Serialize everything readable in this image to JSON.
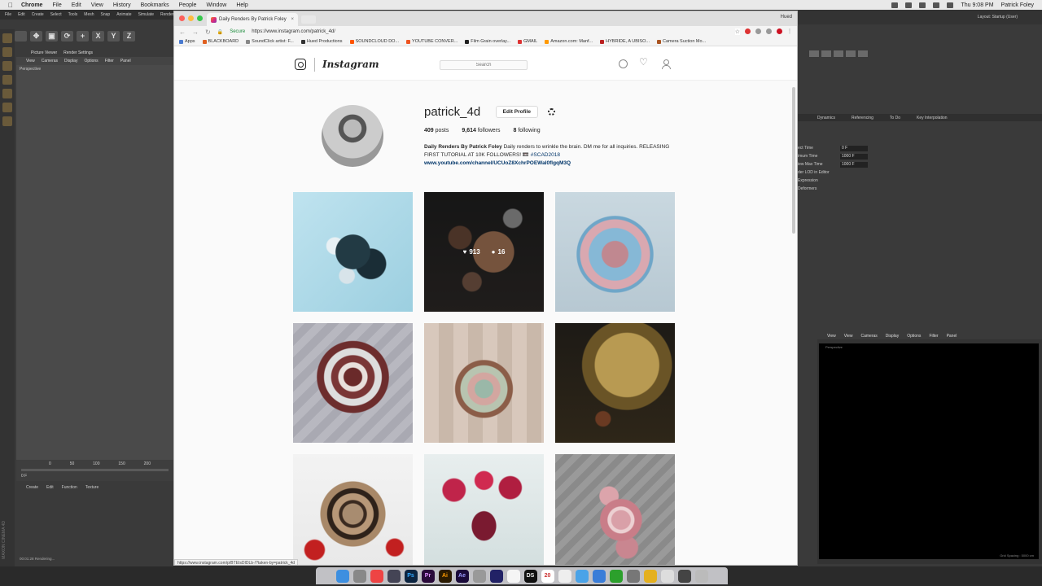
{
  "menubar": {
    "app": "Chrome",
    "items": [
      "File",
      "Edit",
      "View",
      "History",
      "Bookmarks",
      "People",
      "Window",
      "Help"
    ],
    "clock": "Thu 9:08 PM",
    "user": "Patrick Foley"
  },
  "c4d_left": {
    "menu": [
      "File",
      "Edit",
      "Create",
      "Select",
      "Tools",
      "Mesh",
      "Snap",
      "Animate",
      "Simulate",
      "Render"
    ],
    "axis_buttons": [
      "X",
      "Y",
      "Z"
    ],
    "viewer_tabs": [
      "Picture Viewer",
      "Render Settings"
    ],
    "view_menu": [
      "View",
      "Cameras",
      "Display",
      "Options",
      "Filter",
      "Panel"
    ],
    "viewport_label": "Perspective",
    "timeline_ticks": [
      "0",
      "50",
      "100",
      "150",
      "200"
    ],
    "frame_field": "0 F",
    "material_menu": [
      "Create",
      "Edit",
      "Function",
      "Texture"
    ],
    "render_status": "00:01:28 Rendering...",
    "brand": "MAXON CINEMA 4D"
  },
  "c4d_right": {
    "layout_label": "Layout:",
    "layout_value": "Startup (User)",
    "attr_tabs": [
      "Dynamics",
      "Referencing",
      "To Do",
      "Key Interpolation"
    ],
    "attr_rows": [
      {
        "label": "ect Time",
        "value": "0 F"
      },
      {
        "label": "imum Time",
        "value": "1000 F"
      },
      {
        "label": "iew Max Time",
        "value": "1000 F"
      }
    ],
    "lod_label": "der LOD in Editor",
    "expression_label": "Expression",
    "deformers_label": "Deformers",
    "view_tab": "View",
    "view2_menu": [
      "View",
      "Cameras",
      "Display",
      "Options",
      "Filter",
      "Panel"
    ],
    "view2_label": "Perspective",
    "grid_spacing": "Grid Spacing : 5000 cm"
  },
  "browser": {
    "tab_title": "Daily Renders By Patrick Foley",
    "profile_name": "Hued",
    "secure_label": "Secure",
    "url": "https://www.instagram.com/patrick_4d/",
    "bookmarks": [
      "Apps",
      "BLACKBOARD",
      "SoundClick artist: F...",
      "Hued Productions",
      "SOUNDCLOUD DO...",
      "YOUTUBE CONVER...",
      "Film Grain overlay...",
      "GMAIL",
      "Amazon.com: Manf...",
      "HYBRIDE, A UBISO...",
      "Camera Suction Mo..."
    ],
    "status_url": "https://www.instagram.com/p/BTEIsDIDLb-/?taken-by=patrick_4d"
  },
  "instagram": {
    "logo_text": "Instagram",
    "search_placeholder": "Search",
    "username": "patrick_4d",
    "edit_profile_label": "Edit Profile",
    "stats": {
      "posts_count": "409",
      "posts_label": "posts",
      "followers_count": "9,614",
      "followers_label": "followers",
      "following_count": "8",
      "following_label": "following"
    },
    "bio": {
      "name": "Daily Renders By Patrick Foley",
      "text": "Daily renders to wrinkle the brain. DM me for all inquiries. RELEASING FIRST TUTORIAL AT 10K FOLLOWERS! 📼",
      "hashtag": "#SCAD2018",
      "link": "www.youtube.com/channel/UCUoZ8XchrPOEWal0flgqM3Q"
    },
    "hover_post": {
      "likes": "913",
      "comments": "16"
    }
  }
}
